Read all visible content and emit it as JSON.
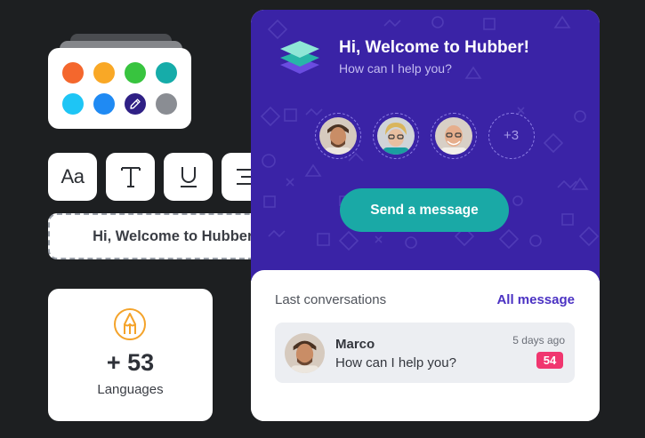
{
  "palette": {
    "colors": [
      "#f4672d",
      "#f9a826",
      "#38c43f",
      "#16aca9",
      "#1ec5f5",
      "#1f8af3",
      "#2f2085",
      "#8a8d93"
    ],
    "selected_color": "#2f2085",
    "selected_icon": "pencil-icon"
  },
  "toolbar": {
    "font_button_label": "Aa",
    "text_tool_icon": "text-t-icon",
    "underline_tool_icon": "underline-icon",
    "align_tool_icon": "align-center-icon"
  },
  "welcome_box": {
    "text": "Hi, Welcome to Hubber!"
  },
  "languages": {
    "icon": "pencil-tip-icon",
    "accent_color": "#f4a32a",
    "count": "+ 53",
    "label": "Languages"
  },
  "chat": {
    "header_color": "#3a23a6",
    "title": "Hi, Welcome to Hubber!",
    "subtitle": "How can I help you?",
    "agents_more": "+3",
    "send_button_label": "Send a message",
    "send_button_color": "#1aa9a6",
    "conversations_heading": "Last conversations",
    "all_messages_link": "All message",
    "conversation": {
      "name": "Marco",
      "message": "How can I help you?",
      "time": "5 days ago",
      "unread": "54",
      "badge_color": "#f0366f"
    }
  }
}
